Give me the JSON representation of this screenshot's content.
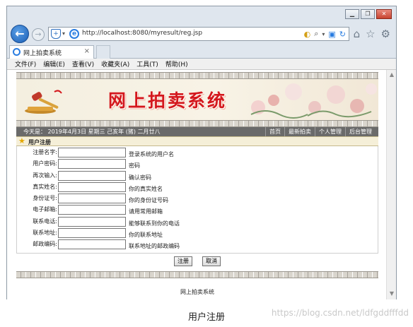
{
  "browser": {
    "url": "http://localhost:8080/myresult/reg.jsp",
    "tab_title": "网上拍卖系统",
    "tab_close": "×",
    "menu": [
      "文件(F)",
      "编辑(E)",
      "查看(V)",
      "收藏夹(A)",
      "工具(T)",
      "帮助(H)"
    ]
  },
  "site": {
    "banner_title": "网上拍卖系统",
    "today": "今天是：  2019年4月3日  星期三  己亥年 (猪) 二月廿八",
    "nav_links": [
      "首页",
      "最新拍卖",
      "个人管理",
      "后台管理"
    ],
    "section_title": "用户注册",
    "footer": "网上拍卖系统"
  },
  "form": {
    "fields": [
      {
        "label": "注册名字:",
        "hint": "登录系统的用户名"
      },
      {
        "label": "用户密码:",
        "hint": "密码"
      },
      {
        "label": "再次输入:",
        "hint": "确认密码"
      },
      {
        "label": "真实姓名:",
        "hint": "你的真实姓名"
      },
      {
        "label": "身份证号:",
        "hint": "你的身份证号码"
      },
      {
        "label": "电子邮箱:",
        "hint": "请用常用邮箱"
      },
      {
        "label": "联系电话:",
        "hint": "能够联系到你的电话"
      },
      {
        "label": "联系地址:",
        "hint": "你的联系地址"
      },
      {
        "label": "邮政编码:",
        "hint": "联系地址的邮政编码"
      }
    ],
    "submit_label": "注册",
    "reset_label": "取消"
  },
  "caption": "用户注册",
  "watermark": "https://blog.csdn.net/ldfgddfffdd"
}
